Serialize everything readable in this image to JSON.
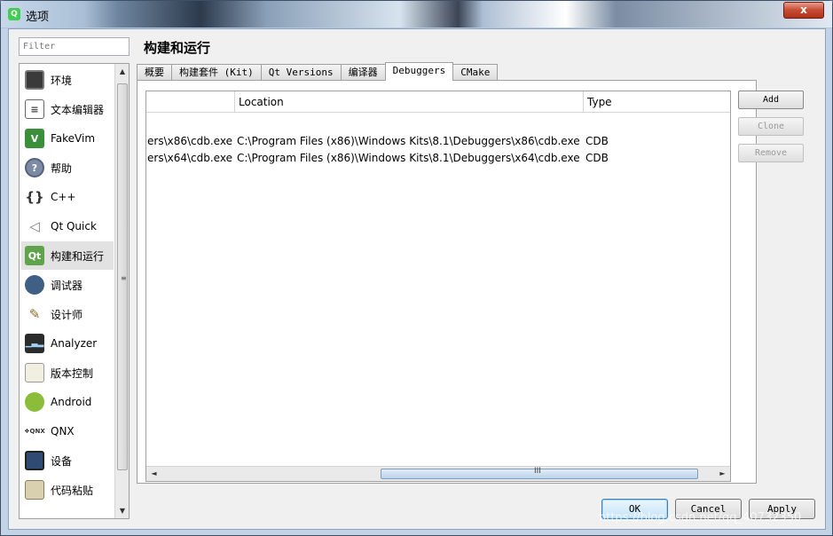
{
  "window": {
    "title": "选项",
    "close_glyph": "x"
  },
  "filter": {
    "placeholder": "Filter"
  },
  "sidebar": {
    "items": [
      {
        "label": "环境",
        "icon": "monitor-icon"
      },
      {
        "label": "文本编辑器",
        "icon": "text-editor-icon"
      },
      {
        "label": "FakeVim",
        "icon": "vim-icon"
      },
      {
        "label": "帮助",
        "icon": "help-icon"
      },
      {
        "label": "C++",
        "icon": "braces-icon"
      },
      {
        "label": "Qt Quick",
        "icon": "paper-plane-icon"
      },
      {
        "label": "构建和运行",
        "icon": "qt-build-run-icon",
        "selected": true
      },
      {
        "label": "调试器",
        "icon": "bug-icon"
      },
      {
        "label": "设计师",
        "icon": "designer-tools-icon"
      },
      {
        "label": "Analyzer",
        "icon": "analyzer-icon"
      },
      {
        "label": "版本控制",
        "icon": "version-control-icon"
      },
      {
        "label": "Android",
        "icon": "android-icon"
      },
      {
        "label": "QNX",
        "icon": "qnx-icon"
      },
      {
        "label": "设备",
        "icon": "device-icon"
      },
      {
        "label": "代码粘贴",
        "icon": "code-paste-icon"
      }
    ]
  },
  "page_title": "构建和运行",
  "tabs": [
    {
      "label": "概要"
    },
    {
      "label": "构建套件 (Kit)"
    },
    {
      "label": "Qt Versions"
    },
    {
      "label": "编译器"
    },
    {
      "label": "Debuggers",
      "active": true
    },
    {
      "label": "CMake"
    }
  ],
  "debuggers_table": {
    "columns": [
      "",
      "Location",
      "Type"
    ],
    "rows": [
      {
        "name": "ers\\x86\\cdb.exe",
        "location": "C:\\Program Files (x86)\\Windows Kits\\8.1\\Debuggers\\x86\\cdb.exe",
        "type": "CDB"
      },
      {
        "name": "ers\\x64\\cdb.exe",
        "location": "C:\\Program Files (x86)\\Windows Kits\\8.1\\Debuggers\\x64\\cdb.exe",
        "type": "CDB"
      }
    ],
    "hscroll_grip": "III"
  },
  "side_buttons": {
    "add": "Add",
    "clone": "Clone",
    "remove": "Remove"
  },
  "footer_buttons": {
    "ok": "OK",
    "cancel": "Cancel",
    "apply": "Apply"
  },
  "watermark": "https://blog.csdn.net/qq_40732350",
  "scroll_glyphs": {
    "up": "▲",
    "down": "▼",
    "left": "◄",
    "right": "►",
    "grip": "≡"
  }
}
